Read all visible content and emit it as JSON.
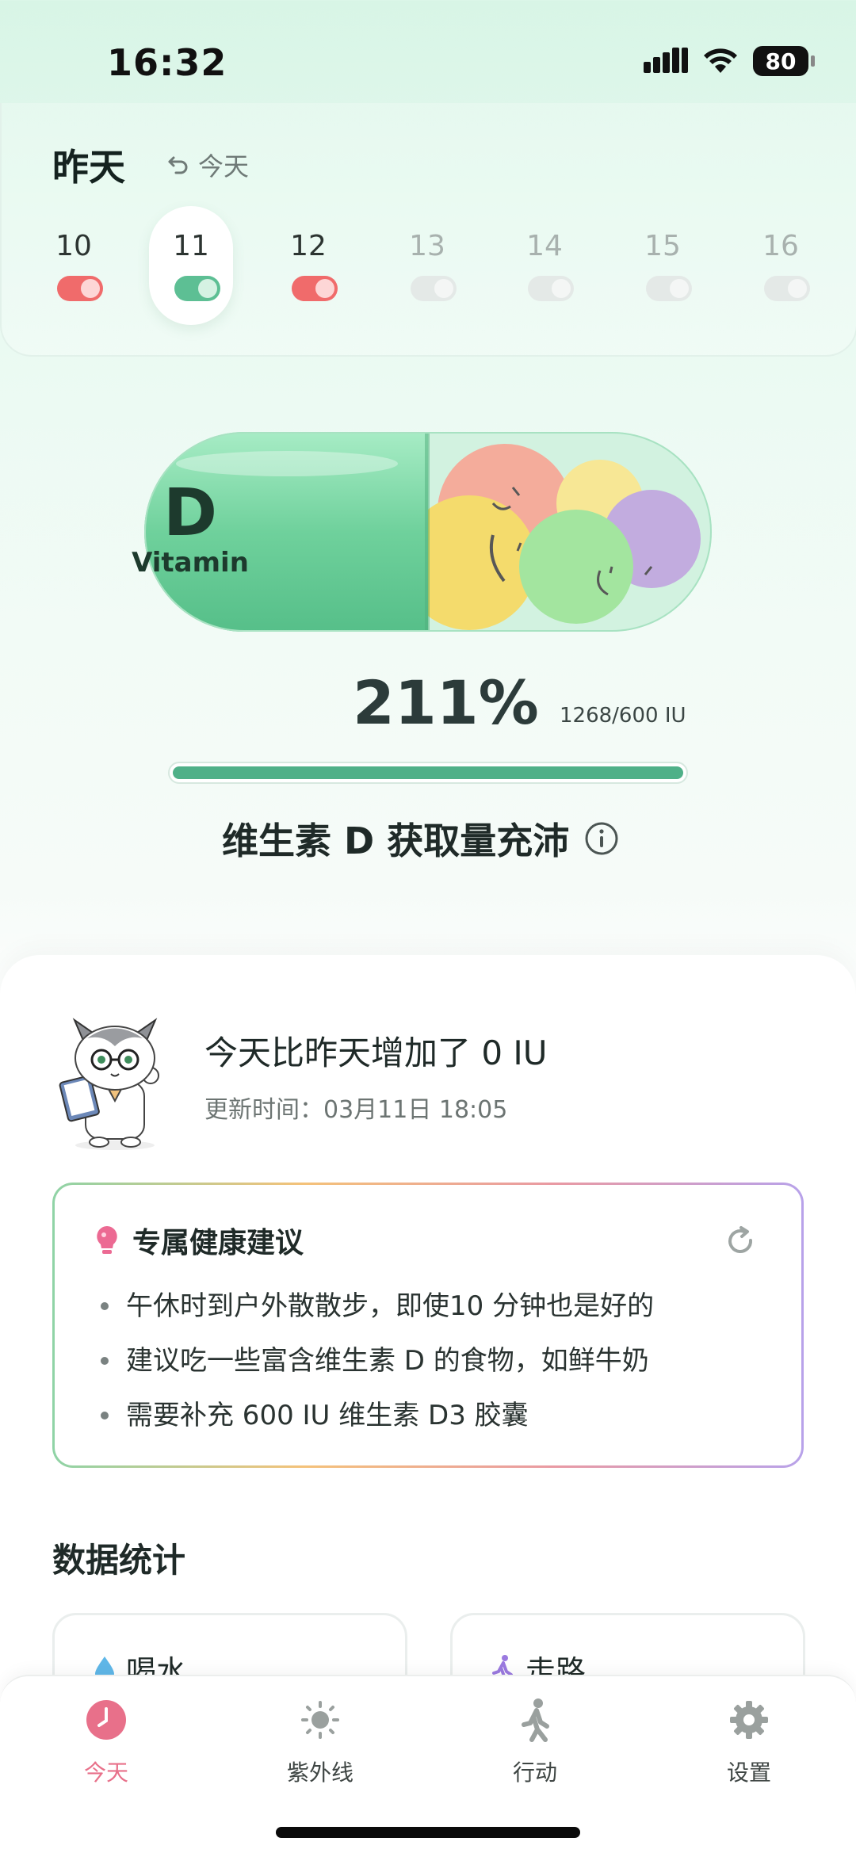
{
  "status_bar": {
    "time": "16:32",
    "battery": "80"
  },
  "header": {
    "day_title": "昨天",
    "back_today": "今天"
  },
  "days": [
    {
      "num": "10",
      "state": "low"
    },
    {
      "num": "11",
      "state": "good"
    },
    {
      "num": "12",
      "state": "low"
    },
    {
      "num": "13",
      "state": "future"
    },
    {
      "num": "14",
      "state": "future"
    },
    {
      "num": "15",
      "state": "future"
    },
    {
      "num": "16",
      "state": "future"
    }
  ],
  "capsule": {
    "letter": "D",
    "word": "Vitamin"
  },
  "intake": {
    "percent": "211%",
    "iu": "1268/600 IU",
    "progress_fraction": 1.0,
    "status": "维生素 D 获取量充沛"
  },
  "summary": {
    "increase": "今天比昨天增加了 0 IU",
    "updated": "更新时间：03月11日 18:05"
  },
  "advice": {
    "title": "专属健康建议",
    "items": [
      "午休时到户外散散步，即使10 分钟也是好的",
      "建议吃一些富含维生素 D 的食物，如鲜牛奶",
      "需要补充 600 IU 维生素 D3 胶囊"
    ]
  },
  "stats": {
    "title": "数据统计",
    "cards": [
      {
        "label": "喝水"
      },
      {
        "label": "走路"
      }
    ]
  },
  "tabs": [
    {
      "label": "今天",
      "icon": "clock-icon",
      "active": true
    },
    {
      "label": "紫外线",
      "icon": "sun-icon",
      "active": false
    },
    {
      "label": "行动",
      "icon": "walk-icon",
      "active": false
    },
    {
      "label": "设置",
      "icon": "gear-icon",
      "active": false
    }
  ],
  "colors": {
    "accent_green": "#4fb088",
    "accent_pink": "#e8708a",
    "low_red": "#f06b6b"
  }
}
